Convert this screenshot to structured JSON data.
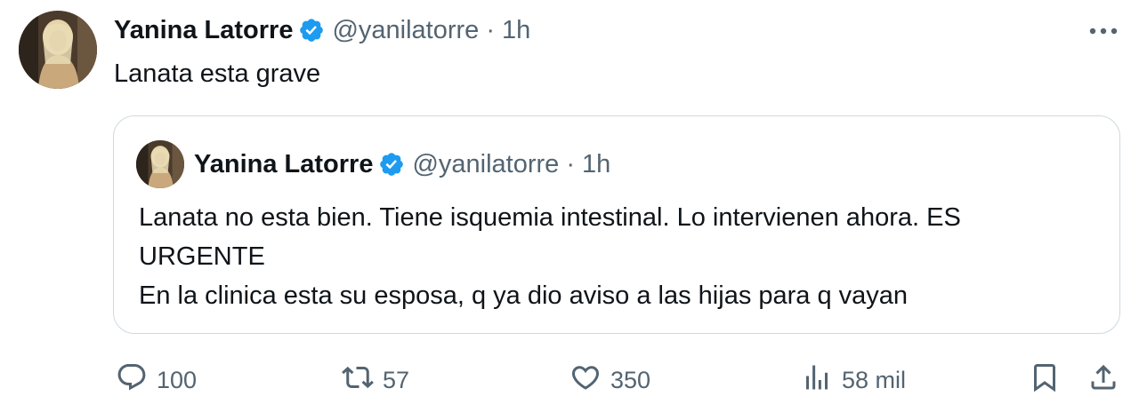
{
  "tweet": {
    "author_name": "Yanina Latorre",
    "handle": "@yanilatorre",
    "separator": "·",
    "time": "1h",
    "text": "Lanata esta grave"
  },
  "quoted_tweet": {
    "author_name": "Yanina Latorre",
    "handle": "@yanilatorre",
    "separator": "·",
    "time": "1h",
    "text_lines": [
      "Lanata no esta bien. Tiene isquemia intestinal. Lo intervienen ahora. ES",
      "URGENTE",
      "En la clinica esta su esposa, q ya dio aviso a las hijas para q vayan"
    ]
  },
  "actions": {
    "replies": "100",
    "reposts": "57",
    "likes": "350",
    "views": "58 mil"
  },
  "icons": {
    "verified": "verified-badge-icon",
    "more": "more-dots-icon",
    "reply": "reply-bubble-icon",
    "repost": "repost-arrows-icon",
    "like": "heart-icon",
    "views": "bar-chart-icon",
    "bookmark": "bookmark-icon",
    "share": "share-upload-icon"
  },
  "colors": {
    "verified": "#1d9bf0",
    "secondary_text": "#536471",
    "primary_text": "#0f1419",
    "border": "#cfd9de"
  }
}
